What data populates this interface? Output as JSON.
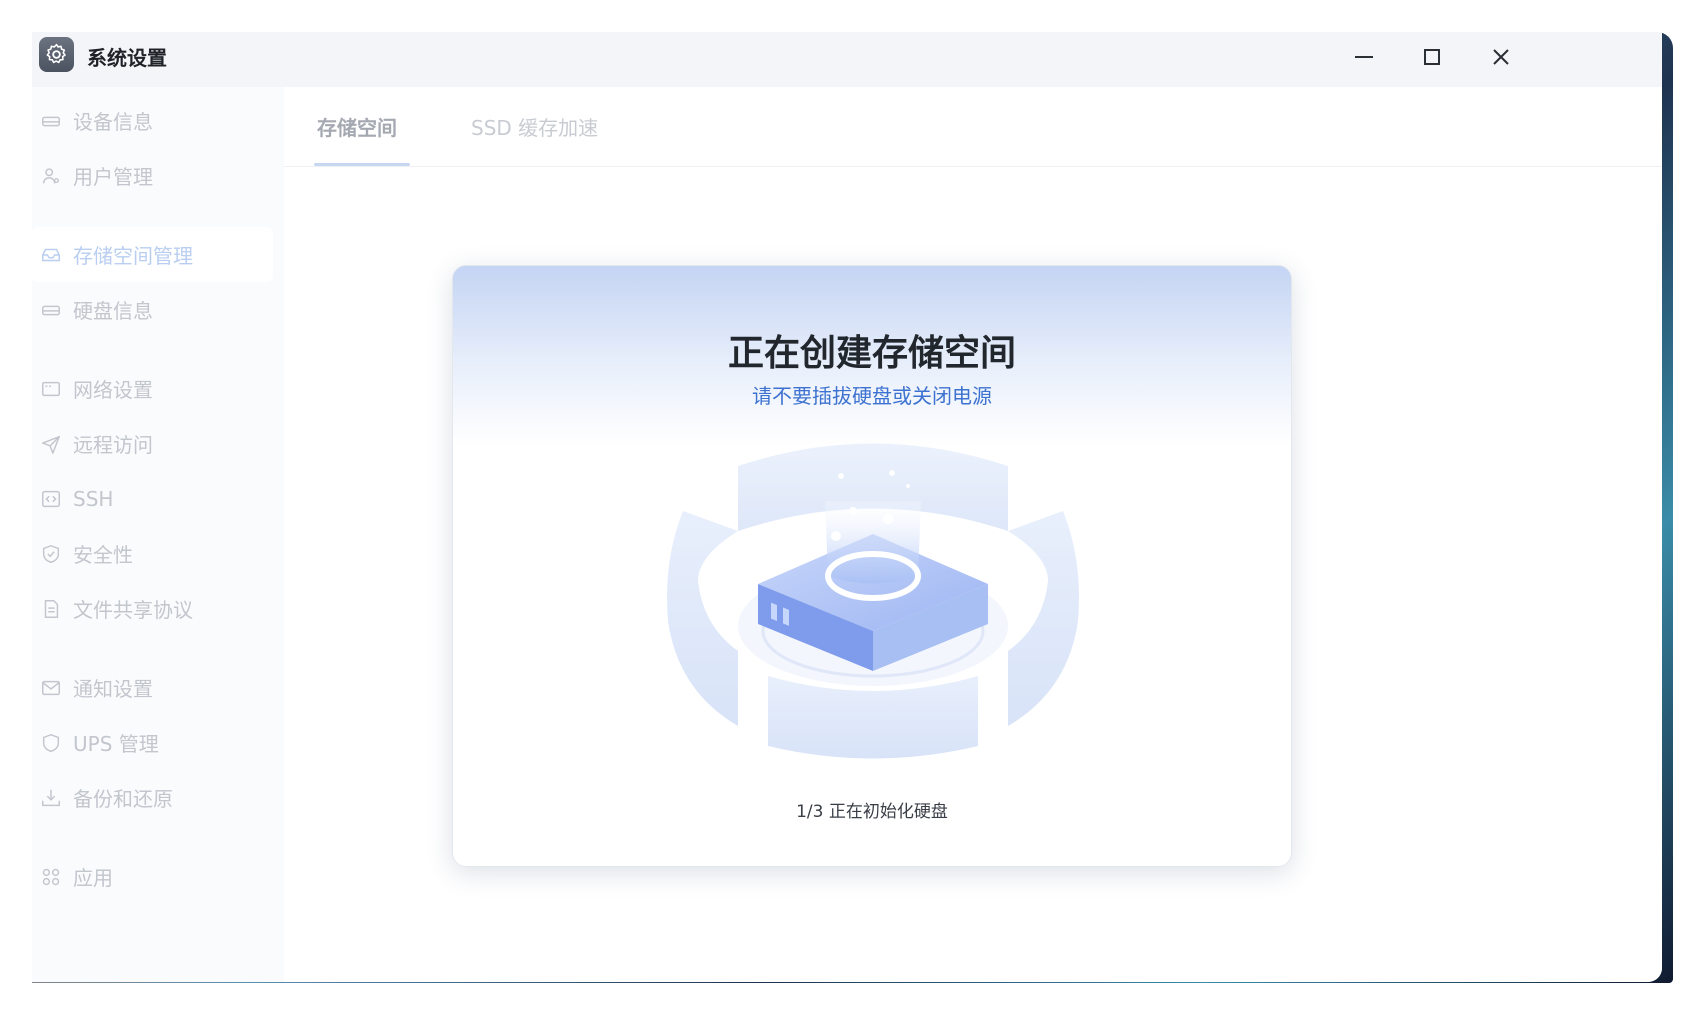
{
  "window": {
    "title": "系统设置",
    "icon": "gear-icon"
  },
  "sidebar": {
    "groups": [
      [
        {
          "label": "设备信息",
          "icon": "device-icon"
        },
        {
          "label": "用户管理",
          "icon": "user-icon"
        }
      ],
      [
        {
          "label": "存储空间管理",
          "icon": "storage-icon",
          "active": true
        },
        {
          "label": "硬盘信息",
          "icon": "disk-icon"
        }
      ],
      [
        {
          "label": "网络设置",
          "icon": "network-icon"
        },
        {
          "label": "远程访问",
          "icon": "send-icon"
        },
        {
          "label": "SSH",
          "icon": "code-icon"
        },
        {
          "label": "安全性",
          "icon": "shield-check-icon"
        },
        {
          "label": "文件共享协议",
          "icon": "file-icon"
        }
      ],
      [
        {
          "label": "通知设置",
          "icon": "mail-icon"
        },
        {
          "label": "UPS 管理",
          "icon": "shield-icon"
        },
        {
          "label": "备份和还原",
          "icon": "download-icon"
        }
      ],
      [
        {
          "label": "应用",
          "icon": "apps-icon"
        }
      ]
    ]
  },
  "tabs": [
    {
      "label": "存储空间",
      "active": true
    },
    {
      "label": "SSD 缓存加速",
      "active": false
    }
  ],
  "dialog": {
    "title": "正在创建存储空间",
    "subtitle": "请不要插拔硬盘或关闭电源",
    "progress_text": "1/3 正在初始化硬盘",
    "illustration_icon": "disk-creating-illustration"
  },
  "colors": {
    "accent": "#3d72d0",
    "active_tab_underline": "#c7d7f1",
    "sidebar_text": "#c2c6cd"
  }
}
